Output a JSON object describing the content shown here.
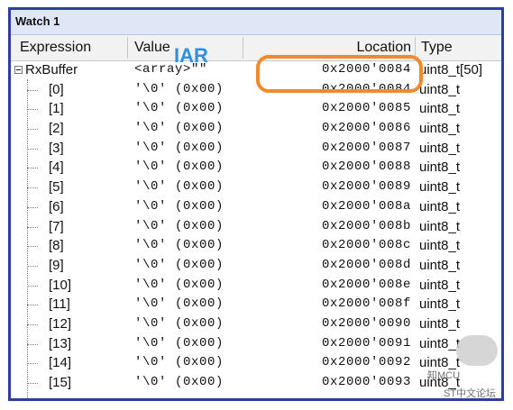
{
  "window": {
    "title": "Watch 1"
  },
  "columns": {
    "expression": "Expression",
    "value": "Value",
    "location": "Location",
    "type": "Type"
  },
  "annotation": {
    "label": "IAR"
  },
  "watermark": {
    "line1": "知MCU",
    "line2": "ST中文论坛"
  },
  "rows": [
    {
      "expr": "RxBuffer",
      "value": "<array>\"\"",
      "location": "0x2000'0084",
      "type": "uint8_t[50]"
    },
    {
      "expr": "[0]",
      "value": "'\\0'  (0x00)",
      "location": "0x2000'0084",
      "type": "uint8_t"
    },
    {
      "expr": "[1]",
      "value": "'\\0'  (0x00)",
      "location": "0x2000'0085",
      "type": "uint8_t"
    },
    {
      "expr": "[2]",
      "value": "'\\0'  (0x00)",
      "location": "0x2000'0086",
      "type": "uint8_t"
    },
    {
      "expr": "[3]",
      "value": "'\\0'  (0x00)",
      "location": "0x2000'0087",
      "type": "uint8_t"
    },
    {
      "expr": "[4]",
      "value": "'\\0'  (0x00)",
      "location": "0x2000'0088",
      "type": "uint8_t"
    },
    {
      "expr": "[5]",
      "value": "'\\0'  (0x00)",
      "location": "0x2000'0089",
      "type": "uint8_t"
    },
    {
      "expr": "[6]",
      "value": "'\\0'  (0x00)",
      "location": "0x2000'008a",
      "type": "uint8_t"
    },
    {
      "expr": "[7]",
      "value": "'\\0'  (0x00)",
      "location": "0x2000'008b",
      "type": "uint8_t"
    },
    {
      "expr": "[8]",
      "value": "'\\0'  (0x00)",
      "location": "0x2000'008c",
      "type": "uint8_t"
    },
    {
      "expr": "[9]",
      "value": "'\\0'  (0x00)",
      "location": "0x2000'008d",
      "type": "uint8_t"
    },
    {
      "expr": "[10]",
      "value": "'\\0'  (0x00)",
      "location": "0x2000'008e",
      "type": "uint8_t"
    },
    {
      "expr": "[11]",
      "value": "'\\0'  (0x00)",
      "location": "0x2000'008f",
      "type": "uint8_t"
    },
    {
      "expr": "[12]",
      "value": "'\\0'  (0x00)",
      "location": "0x2000'0090",
      "type": "uint8_t"
    },
    {
      "expr": "[13]",
      "value": "'\\0'  (0x00)",
      "location": "0x2000'0091",
      "type": "uint8_t"
    },
    {
      "expr": "[14]",
      "value": "'\\0'  (0x00)",
      "location": "0x2000'0092",
      "type": "uint8_t"
    },
    {
      "expr": "[15]",
      "value": "'\\0'  (0x00)",
      "location": "0x2000'0093",
      "type": "uint8_t"
    }
  ]
}
